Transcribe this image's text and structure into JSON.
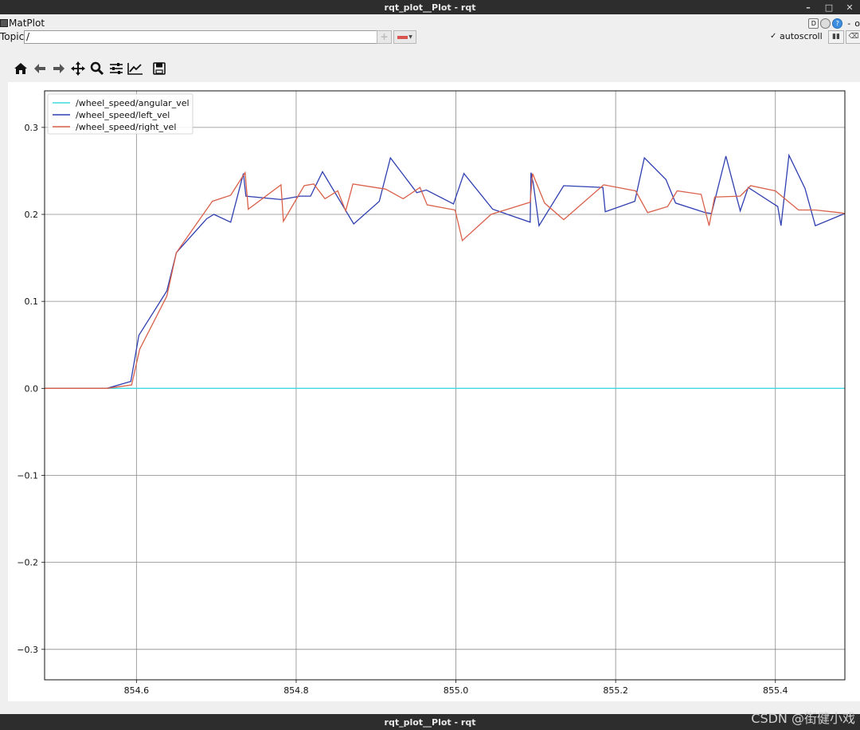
{
  "window": {
    "title": "rqt_plot__Plot - rqt",
    "minimize": "–",
    "maximize": "□",
    "close": "✕"
  },
  "plugin": {
    "name": "MatPlot",
    "d_label": "D",
    "help_label": "?",
    "dash": "-",
    "close_label": "o"
  },
  "topic": {
    "label": "Topic",
    "value": "/",
    "add_label": "+"
  },
  "autoscroll": {
    "label": "autoscroll",
    "checked": true,
    "checkmark": "✓",
    "pause_label": "▮▮",
    "clear_label": "⌫"
  },
  "toolbar": [
    {
      "name": "home-icon"
    },
    {
      "name": "back-icon"
    },
    {
      "name": "forward-icon"
    },
    {
      "name": "pan-icon"
    },
    {
      "name": "zoom-icon"
    },
    {
      "name": "configure-subplots-icon"
    },
    {
      "name": "edit-axis-icon"
    },
    {
      "name": "save-icon"
    }
  ],
  "status": {
    "title": "rqt_plot__Plot - rqt"
  },
  "watermark": "CSDN @街健小戏",
  "colors": {
    "angular": "#3fdbe0",
    "left": "#2f3fb0",
    "right": "#d9604a",
    "grid": "#8a8a8a"
  },
  "chart_data": {
    "type": "line",
    "title": "",
    "xlabel": "",
    "ylabel": "",
    "xlim": [
      854.485,
      855.487
    ],
    "ylim": [
      -0.335,
      0.342
    ],
    "x_ticks": [
      854.6,
      854.8,
      855.0,
      855.2,
      855.4
    ],
    "x_tick_labels": [
      "854.6",
      "854.8",
      "855.0",
      "855.2",
      "855.4"
    ],
    "y_ticks": [
      -0.3,
      -0.2,
      -0.1,
      0.0,
      0.1,
      0.2,
      0.3
    ],
    "y_tick_labels": [
      "−0.3",
      "−0.2",
      "−0.1",
      "0.0",
      "0.1",
      "0.2",
      "0.3"
    ],
    "grid": true,
    "legend_position": "top-left",
    "series": [
      {
        "name": "/wheel_speed/angular_vel",
        "color": "#3fdbe0",
        "x": [
          854.485,
          855.487
        ],
        "y": [
          0.0,
          0.0
        ]
      },
      {
        "name": "/wheel_speed/left_vel",
        "color": "#2f3fb0",
        "x": [
          854.485,
          854.563,
          854.593,
          854.603,
          854.638,
          854.65,
          854.688,
          854.697,
          854.718,
          854.734,
          854.737,
          854.781,
          854.805,
          854.818,
          854.833,
          854.872,
          854.904,
          854.918,
          854.951,
          854.963,
          854.997,
          855.01,
          855.046,
          855.093,
          855.094,
          855.097,
          855.104,
          855.135,
          855.184,
          855.187,
          855.224,
          855.236,
          855.263,
          855.275,
          855.312,
          855.32,
          855.338,
          855.356,
          855.366,
          855.403,
          855.407,
          855.417,
          855.437,
          855.45,
          855.487
        ],
        "y": [
          0.0,
          0.0,
          0.008,
          0.061,
          0.112,
          0.156,
          0.195,
          0.2,
          0.191,
          0.247,
          0.221,
          0.217,
          0.221,
          0.221,
          0.249,
          0.189,
          0.215,
          0.265,
          0.225,
          0.228,
          0.212,
          0.247,
          0.206,
          0.191,
          0.248,
          0.235,
          0.187,
          0.233,
          0.231,
          0.203,
          0.215,
          0.265,
          0.24,
          0.213,
          0.202,
          0.201,
          0.267,
          0.204,
          0.231,
          0.209,
          0.187,
          0.268,
          0.23,
          0.187,
          0.201
        ]
      },
      {
        "name": "/wheel_speed/right_vel",
        "color": "#d9604a",
        "x": [
          854.485,
          854.563,
          854.594,
          854.604,
          854.638,
          854.65,
          854.695,
          854.718,
          854.736,
          854.74,
          854.781,
          854.784,
          854.81,
          854.822,
          854.836,
          854.852,
          854.862,
          854.871,
          854.912,
          854.934,
          854.955,
          854.964,
          854.999,
          855.008,
          855.044,
          855.093,
          855.096,
          855.111,
          855.135,
          855.185,
          855.225,
          855.24,
          855.265,
          855.277,
          855.307,
          855.317,
          855.324,
          855.356,
          855.369,
          855.4,
          855.429,
          855.45,
          855.48,
          855.487
        ],
        "y": [
          0.0,
          0.0,
          0.004,
          0.045,
          0.106,
          0.156,
          0.215,
          0.222,
          0.248,
          0.206,
          0.234,
          0.192,
          0.233,
          0.235,
          0.218,
          0.227,
          0.204,
          0.235,
          0.229,
          0.218,
          0.231,
          0.211,
          0.205,
          0.17,
          0.2,
          0.214,
          0.247,
          0.213,
          0.194,
          0.234,
          0.227,
          0.202,
          0.209,
          0.227,
          0.223,
          0.187,
          0.22,
          0.221,
          0.233,
          0.227,
          0.205,
          0.205,
          0.202,
          0.201
        ]
      }
    ]
  }
}
